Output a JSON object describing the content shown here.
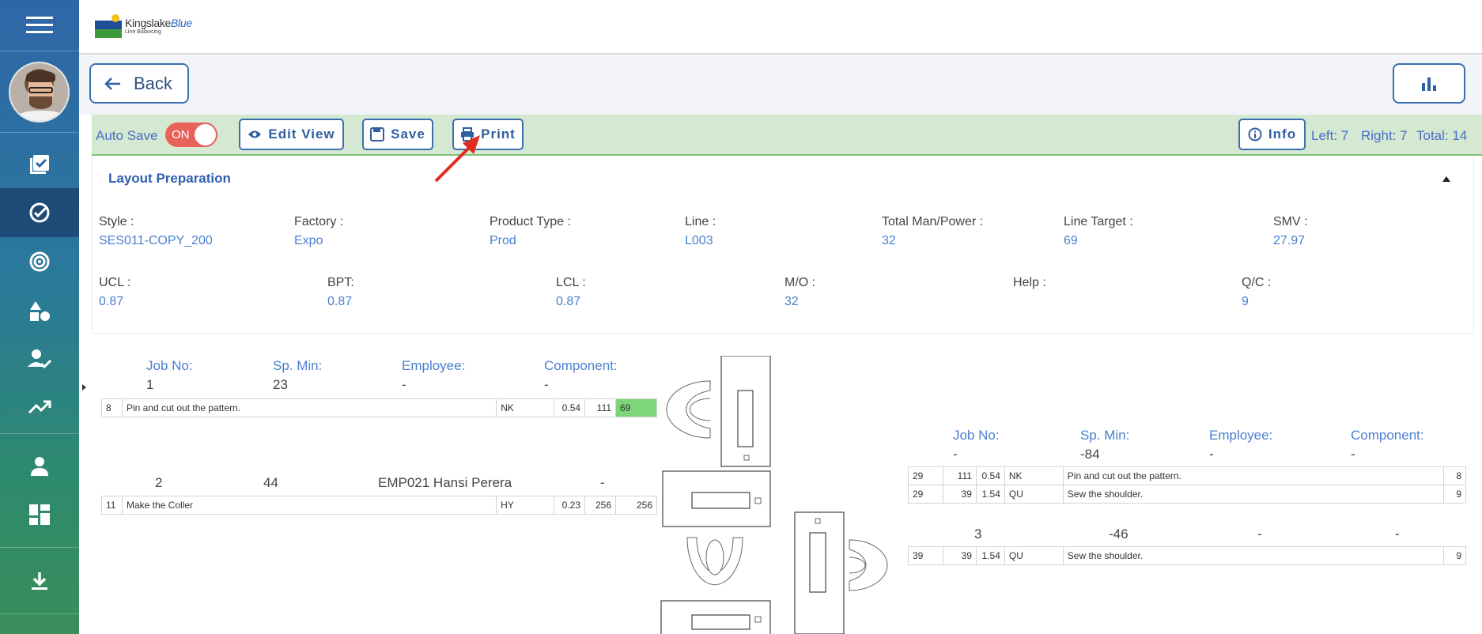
{
  "header": {
    "brand_main": "Kingslake",
    "brand_accent": "Blue",
    "brand_sub": "Line Balancing"
  },
  "sidebar": {
    "items": [
      {
        "name": "menu-icon"
      },
      {
        "name": "checklist-icon"
      },
      {
        "name": "check-circle-icon",
        "active": true
      },
      {
        "name": "target-icon"
      },
      {
        "name": "shapes-icon"
      },
      {
        "name": "user-check-icon"
      },
      {
        "name": "trending-up-icon"
      },
      {
        "name": "person-icon"
      },
      {
        "name": "dashboard-icon"
      },
      {
        "name": "download-icon"
      }
    ]
  },
  "subheader": {
    "back_label": "Back"
  },
  "toolbar": {
    "auto_save_label": "Auto Save",
    "toggle_label": "ON",
    "edit_view_label": "Edit View",
    "save_label": "Save",
    "print_label": "Print",
    "info_label": "Info",
    "left": "Left: 7",
    "right": "Right: 7",
    "total": "Total: 14"
  },
  "card": {
    "title": "Layout Preparation",
    "row1": [
      {
        "label": "Style :",
        "value": "SES011-COPY_200"
      },
      {
        "label": "Factory :",
        "value": "Expo"
      },
      {
        "label": "Product Type :",
        "value": "Prod"
      },
      {
        "label": "Line :",
        "value": "L003"
      },
      {
        "label": "Total Man/Power :",
        "value": "32"
      },
      {
        "label": "Line Target :",
        "value": "69"
      },
      {
        "label": "SMV :",
        "value": "27.97"
      }
    ],
    "row2": [
      {
        "label": "UCL :",
        "value": "0.87"
      },
      {
        "label": "BPT:",
        "value": "0.87"
      },
      {
        "label": "LCL :",
        "value": "0.87"
      },
      {
        "label": "M/O :",
        "value": "32"
      },
      {
        "label": "Help :",
        "value": ""
      },
      {
        "label": "Q/C :",
        "value": "9"
      }
    ]
  },
  "left_panel": {
    "headers": [
      "Job No:",
      "Sp. Min:",
      "Employee:",
      "Component:"
    ],
    "job1": {
      "job_no": "1",
      "sp_min": "23",
      "employee": "-",
      "component": "-"
    },
    "job1_row": [
      "8",
      "Pin and cut out the pattern.",
      "NK",
      "0.54",
      "111",
      "69"
    ],
    "job2": {
      "job_no": "2",
      "sp_min": "44",
      "employee": "EMP021 Hansi Perera",
      "component": "-"
    },
    "job2_row": [
      "11",
      "Make the Coller",
      "HY",
      "0.23",
      "256",
      "256"
    ]
  },
  "right_panel": {
    "headers": [
      "Job No:",
      "Sp. Min:",
      "Employee:",
      "Component:"
    ],
    "jobA": {
      "job_no": "-",
      "sp_min": "-84",
      "employee": "-",
      "component": "-"
    },
    "jobA_rows": [
      [
        "29",
        "111",
        "0.54",
        "NK",
        "Pin and cut out the pattern.",
        "8"
      ],
      [
        "29",
        "39",
        "1.54",
        "QU",
        "Sew the shoulder.",
        "9"
      ]
    ],
    "jobB": {
      "job_no": "3",
      "sp_min": "-46",
      "employee": "-",
      "component": "-"
    },
    "jobB_row": [
      "39",
      "39",
      "1.54",
      "QU",
      "Sew the shoulder.",
      "9"
    ]
  },
  "colors": {
    "accent": "#2f5fb0",
    "toolbar_bg": "#d4e8d2",
    "toggle_on": "#e8625a",
    "highlight_green": "#7fd67a",
    "arrow": "#e02b20"
  }
}
